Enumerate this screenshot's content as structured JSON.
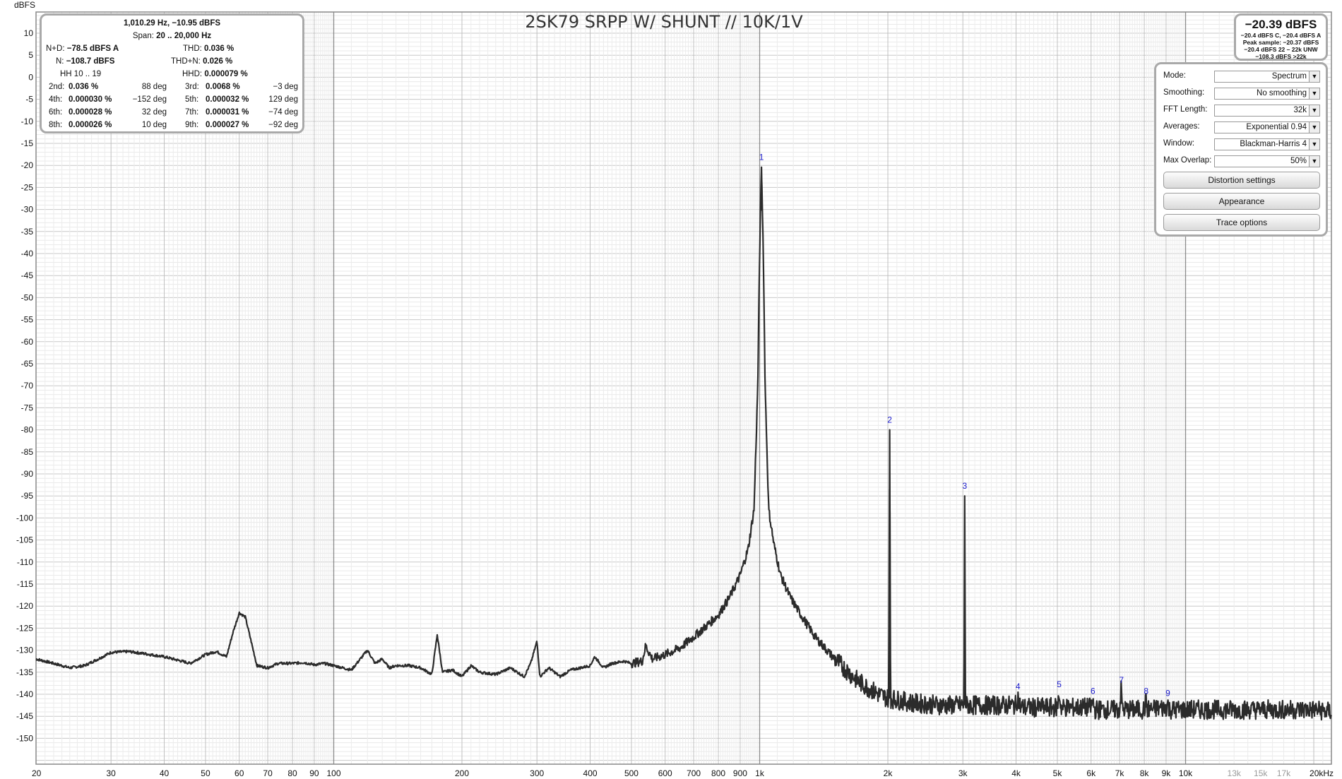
{
  "chart_data": {
    "type": "line",
    "title": "2SK79 SRPP W/ SHUNT // 10K/1V",
    "ylabel": "dBFS",
    "xlabel": "",
    "x_scale": "log",
    "xlim": [
      20,
      22000
    ],
    "ylim": [
      -155,
      10
    ],
    "grid": true,
    "y_ticks": [
      10,
      5,
      0,
      -5,
      -10,
      -15,
      -20,
      -25,
      -30,
      -35,
      -40,
      -45,
      -50,
      -55,
      -60,
      -65,
      -70,
      -75,
      -80,
      -85,
      -90,
      -95,
      -100,
      -105,
      -110,
      -115,
      -120,
      -125,
      -130,
      -135,
      -140,
      -145,
      -150
    ],
    "x_ticks": [
      {
        "v": 20,
        "label": "20"
      },
      {
        "v": 30,
        "label": "30"
      },
      {
        "v": 40,
        "label": "40"
      },
      {
        "v": 50,
        "label": "50"
      },
      {
        "v": 60,
        "label": "60"
      },
      {
        "v": 70,
        "label": "70"
      },
      {
        "v": 80,
        "label": "80"
      },
      {
        "v": 90,
        "label": "90"
      },
      {
        "v": 100,
        "label": "100"
      },
      {
        "v": 200,
        "label": "200"
      },
      {
        "v": 300,
        "label": "300"
      },
      {
        "v": 400,
        "label": "400"
      },
      {
        "v": 500,
        "label": "500"
      },
      {
        "v": 600,
        "label": "600"
      },
      {
        "v": 700,
        "label": "700"
      },
      {
        "v": 800,
        "label": "800"
      },
      {
        "v": 900,
        "label": "900"
      },
      {
        "v": 1000,
        "label": "1k"
      },
      {
        "v": 2000,
        "label": "2k"
      },
      {
        "v": 3000,
        "label": "3k"
      },
      {
        "v": 4000,
        "label": "4k"
      },
      {
        "v": 5000,
        "label": "5k"
      },
      {
        "v": 6000,
        "label": "6k"
      },
      {
        "v": 7000,
        "label": "7k"
      },
      {
        "v": 8000,
        "label": "8k"
      },
      {
        "v": 9000,
        "label": "9k"
      },
      {
        "v": 10000,
        "label": "10k"
      },
      {
        "v": 13000,
        "label": "13k",
        "faint": true
      },
      {
        "v": 15000,
        "label": "15k",
        "faint": true
      },
      {
        "v": 17000,
        "label": "17k",
        "faint": true
      },
      {
        "v": 20000,
        "label": "20kHz"
      }
    ],
    "series": [
      {
        "color": "#2b2b2b",
        "points": [
          [
            20,
            -132
          ],
          [
            22,
            -133
          ],
          [
            24,
            -134
          ],
          [
            26,
            -133.5
          ],
          [
            28,
            -132
          ],
          [
            30,
            -130.5
          ],
          [
            33,
            -130.3
          ],
          [
            36,
            -130.8
          ],
          [
            40,
            -131.5
          ],
          [
            44,
            -132.5
          ],
          [
            46,
            -133
          ],
          [
            50,
            -131
          ],
          [
            53,
            -130.3
          ],
          [
            56,
            -131.5
          ],
          [
            58,
            -126
          ],
          [
            60,
            -121.5
          ],
          [
            62,
            -122.5
          ],
          [
            64,
            -128
          ],
          [
            66,
            -133.5
          ],
          [
            70,
            -134
          ],
          [
            74,
            -133
          ],
          [
            80,
            -133
          ],
          [
            85,
            -132.8
          ],
          [
            90,
            -133.3
          ],
          [
            95,
            -133
          ],
          [
            100,
            -133.5
          ],
          [
            110,
            -134.5
          ],
          [
            120,
            -130
          ],
          [
            125,
            -133
          ],
          [
            130,
            -132
          ],
          [
            135,
            -134
          ],
          [
            140,
            -133.5
          ],
          [
            150,
            -133.5
          ],
          [
            160,
            -134
          ],
          [
            170,
            -135.5
          ],
          [
            175,
            -126.5
          ],
          [
            180,
            -135
          ],
          [
            190,
            -134.5
          ],
          [
            200,
            -136
          ],
          [
            210,
            -133.5
          ],
          [
            220,
            -135
          ],
          [
            240,
            -135.5
          ],
          [
            260,
            -134
          ],
          [
            280,
            -136
          ],
          [
            290,
            -133
          ],
          [
            300,
            -128
          ],
          [
            305,
            -136
          ],
          [
            320,
            -134
          ],
          [
            340,
            -136
          ],
          [
            360,
            -134.5
          ],
          [
            380,
            -134
          ],
          [
            400,
            -133.5
          ],
          [
            410,
            -131.5
          ],
          [
            430,
            -134
          ],
          [
            450,
            -133
          ],
          [
            480,
            -132.5
          ],
          [
            500,
            -133
          ],
          [
            530,
            -132.5
          ],
          [
            540,
            -129
          ],
          [
            560,
            -132
          ],
          [
            600,
            -131
          ],
          [
            650,
            -129.5
          ],
          [
            700,
            -127
          ],
          [
            750,
            -124.5
          ],
          [
            800,
            -122
          ],
          [
            850,
            -118
          ],
          [
            900,
            -113
          ],
          [
            940,
            -107
          ],
          [
            970,
            -98
          ],
          [
            990,
            -70
          ],
          [
            1000,
            -40
          ],
          [
            1010,
            -20.4
          ],
          [
            1020,
            -40
          ],
          [
            1030,
            -70
          ],
          [
            1050,
            -98
          ],
          [
            1080,
            -106
          ],
          [
            1120,
            -113
          ],
          [
            1180,
            -118
          ],
          [
            1250,
            -122
          ],
          [
            1350,
            -127
          ],
          [
            1500,
            -132
          ],
          [
            1700,
            -137
          ],
          [
            1900,
            -140
          ],
          [
            2010,
            -141
          ],
          [
            2020,
            -80
          ],
          [
            2030,
            -141
          ],
          [
            2300,
            -142
          ],
          [
            2700,
            -142.5
          ],
          [
            3020,
            -142.5
          ],
          [
            3030,
            -95
          ],
          [
            3040,
            -142.5
          ],
          [
            3500,
            -142.5
          ],
          [
            4000,
            -142.5
          ],
          [
            4040,
            -140.5
          ],
          [
            4100,
            -143
          ],
          [
            5000,
            -143
          ],
          [
            5050,
            -140
          ],
          [
            5100,
            -143
          ],
          [
            6000,
            -143
          ],
          [
            6060,
            -141.5
          ],
          [
            6120,
            -143.5
          ],
          [
            7000,
            -143.5
          ],
          [
            7060,
            -139
          ],
          [
            7120,
            -143.5
          ],
          [
            8000,
            -143.5
          ],
          [
            8080,
            -141.5
          ],
          [
            8150,
            -143.5
          ],
          [
            9000,
            -143
          ],
          [
            9090,
            -142
          ],
          [
            9150,
            -143.5
          ],
          [
            12000,
            -143.5
          ],
          [
            16000,
            -143.5
          ],
          [
            20000,
            -143.5
          ],
          [
            22000,
            -144
          ]
        ]
      }
    ],
    "annotations": [
      {
        "text": "1",
        "x": 1010,
        "y": -20.4
      },
      {
        "text": "2",
        "x": 2020,
        "y": -80
      },
      {
        "text": "3",
        "x": 3030,
        "y": -95
      },
      {
        "text": "4",
        "x": 4040,
        "y": -140.5
      },
      {
        "text": "5",
        "x": 5050,
        "y": -140
      },
      {
        "text": "6",
        "x": 6060,
        "y": -141.5
      },
      {
        "text": "7",
        "x": 7070,
        "y": -139
      },
      {
        "text": "8",
        "x": 8080,
        "y": -141.5
      },
      {
        "text": "9",
        "x": 9090,
        "y": -142
      }
    ]
  },
  "stats": {
    "line1": "1,010.29 Hz, −10.95 dBFS",
    "span_label": "Span:",
    "span_value": "20 .. 20,000 Hz",
    "nd_label": "N+D:",
    "nd_value": "−78.5 dBFS A",
    "thd_label": "THD:",
    "thd_value": "0.036 %",
    "n_label": "N:",
    "n_value": "−108.7 dBFS",
    "thdn_label": "THD+N:",
    "thdn_value": "0.026 %",
    "hh_label": "HH 10 .. 19",
    "hhd_label": "HHD:",
    "hhd_value": "0.000079 %",
    "harmonics": [
      {
        "l1": "2nd:",
        "v1": "0.036 %",
        "d1": "88 deg",
        "l2": "3rd:",
        "v2": "0.0068 %",
        "d2": "−3 deg"
      },
      {
        "l1": "4th:",
        "v1": "0.000030 %",
        "d1": "−152 deg",
        "l2": "5th:",
        "v2": "0.000032 %",
        "d2": "129 deg"
      },
      {
        "l1": "6th:",
        "v1": "0.000028 %",
        "d1": "32 deg",
        "l2": "7th:",
        "v2": "0.000031 %",
        "d2": "−74 deg"
      },
      {
        "l1": "8th:",
        "v1": "0.000026 %",
        "d1": "10 deg",
        "l2": "9th:",
        "v2": "0.000027 %",
        "d2": "−92 deg"
      }
    ]
  },
  "level": {
    "main": "−20.39 dBFS",
    "line1": "−20.4 dBFS C, −20.4 dBFS A",
    "line2": "Peak sample: −20.37 dBFS",
    "line3": "−20.4 dBFS 22 – 22k UNW",
    "line4": "−108.3 dBFS >22k"
  },
  "controls": {
    "mode_label": "Mode:",
    "mode_value": "Spectrum",
    "smoothing_label": "Smoothing:",
    "smoothing_value": "No  smoothing",
    "fft_label": "FFT Length:",
    "fft_value": "32k",
    "averages_label": "Averages:",
    "averages_value": "Exponential 0.94",
    "window_label": "Window:",
    "window_value": "Blackman-Harris 4",
    "overlap_label": "Max Overlap:",
    "overlap_value": "50%",
    "distortion_button": "Distortion settings",
    "appearance_button": "Appearance",
    "trace_button": "Trace options"
  }
}
